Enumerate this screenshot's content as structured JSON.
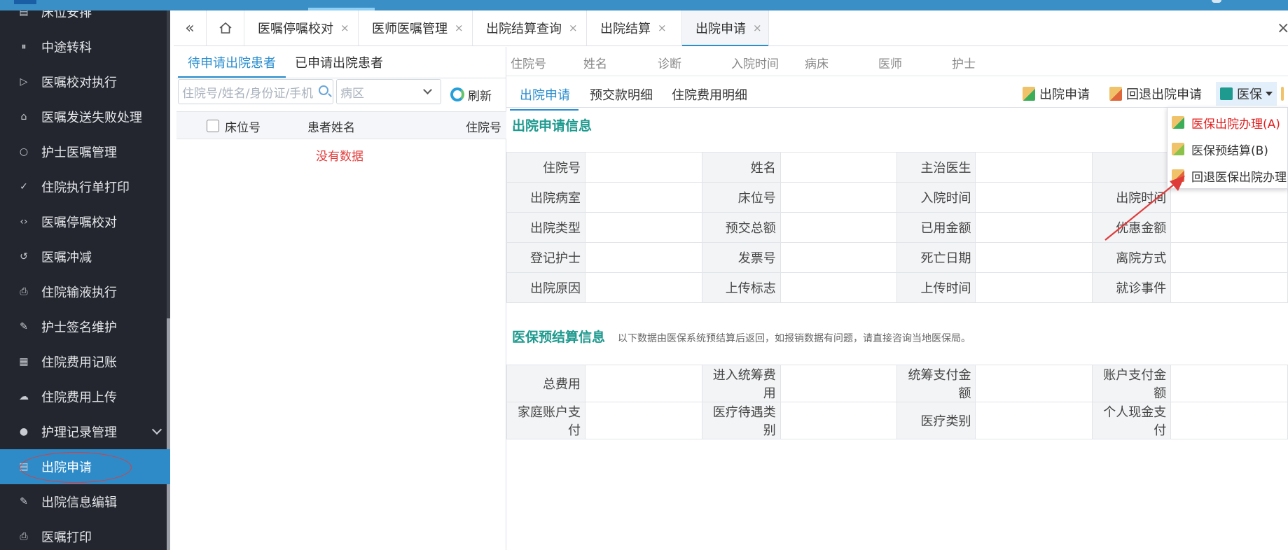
{
  "colors": {
    "sidebar_bg": "#23262e",
    "active_blue": "#2e8bc8",
    "accent": "#2a8ecf",
    "section_title": "#1f9a8f",
    "empty_text": "#e23c3c",
    "annotation_red": "#e03b3b"
  },
  "sidebar": {
    "items": [
      {
        "label": "床位安排",
        "icon": "bed-list-icon"
      },
      {
        "label": "中途转科",
        "icon": "pause-circle-icon"
      },
      {
        "label": "医嘱校对执行",
        "icon": "play-circle-icon"
      },
      {
        "label": "医嘱发送失败处理",
        "icon": "home-icon"
      },
      {
        "label": "护士医嘱管理",
        "icon": "circle-icon"
      },
      {
        "label": "住院执行单打印",
        "icon": "check-circle-icon"
      },
      {
        "label": "医嘱停嘱校对",
        "icon": "code-circle-icon"
      },
      {
        "label": "医嘱冲减",
        "icon": "back-circle-icon"
      },
      {
        "label": "住院输液执行",
        "icon": "printer-icon"
      },
      {
        "label": "护士签名维护",
        "icon": "pen-icon"
      },
      {
        "label": "住院费用记账",
        "icon": "table-icon"
      },
      {
        "label": "住院费用上传",
        "icon": "cloud-upload-icon"
      },
      {
        "label": "护理记录管理",
        "icon": "disc-icon"
      },
      {
        "label": "出院申请",
        "icon": "document-icon"
      },
      {
        "label": "出院信息编辑",
        "icon": "pen-icon"
      },
      {
        "label": "医嘱打印",
        "icon": "printer-icon"
      }
    ]
  },
  "tabs": [
    {
      "label": "医嘱停嘱校对",
      "closable": true
    },
    {
      "label": "医师医嘱管理",
      "closable": true
    },
    {
      "label": "出院结算查询",
      "closable": true
    },
    {
      "label": "出院结算",
      "closable": true
    },
    {
      "label": "出院申请",
      "closable": true
    }
  ],
  "close_glyph": "×",
  "left_panel": {
    "tabs": [
      "待申请出院患者",
      "已申请出院患者"
    ],
    "search_placeholder": "住院号/姓名/身份证/手机",
    "ward_placeholder": "病区",
    "refresh_label": "刷新",
    "columns": [
      "床位号",
      "患者姓名",
      "住院号"
    ],
    "empty_text": "没有数据"
  },
  "patient_header": [
    "住院号",
    "姓名",
    "诊断",
    "入院时间",
    "病床",
    "医师",
    "护士"
  ],
  "sub_tabs": [
    "出院申请",
    "预交款明细",
    "住院费用明细"
  ],
  "toolbar": {
    "apply_label": "出院申请",
    "revoke_label": "回退出院申请",
    "insurance_label": "医保"
  },
  "dropdown": [
    {
      "label": "医保出院办理(A)",
      "highlight": true
    },
    {
      "label": "医保预结算(B)",
      "highlight": false
    },
    {
      "label": "回退医保出院办理",
      "highlight": false
    }
  ],
  "discharge_section": {
    "title": "出院申请信息",
    "rows": [
      [
        "住院号",
        "姓名",
        "主治医生",
        ""
      ],
      [
        "出院病室",
        "床位号",
        "入院时间",
        "出院时间"
      ],
      [
        "出院类型",
        "预交总额",
        "已用金额",
        "优惠金额"
      ],
      [
        "登记护士",
        "发票号",
        "死亡日期",
        "离院方式"
      ],
      [
        "出院原因",
        "上传标志",
        "上传时间",
        "就诊事件"
      ]
    ]
  },
  "insurance_section": {
    "title": "医保预结算信息",
    "note": "以下数据由医保系统预结算后返回，如报销数据有问题，请直接咨询当地医保局。",
    "rows": [
      [
        "总费用",
        "进入统筹费用",
        "统筹支付金额",
        "账户支付金额"
      ],
      [
        "家庭账户支付",
        "医疗待遇类别",
        "医疗类别",
        "个人现金支付"
      ]
    ]
  }
}
